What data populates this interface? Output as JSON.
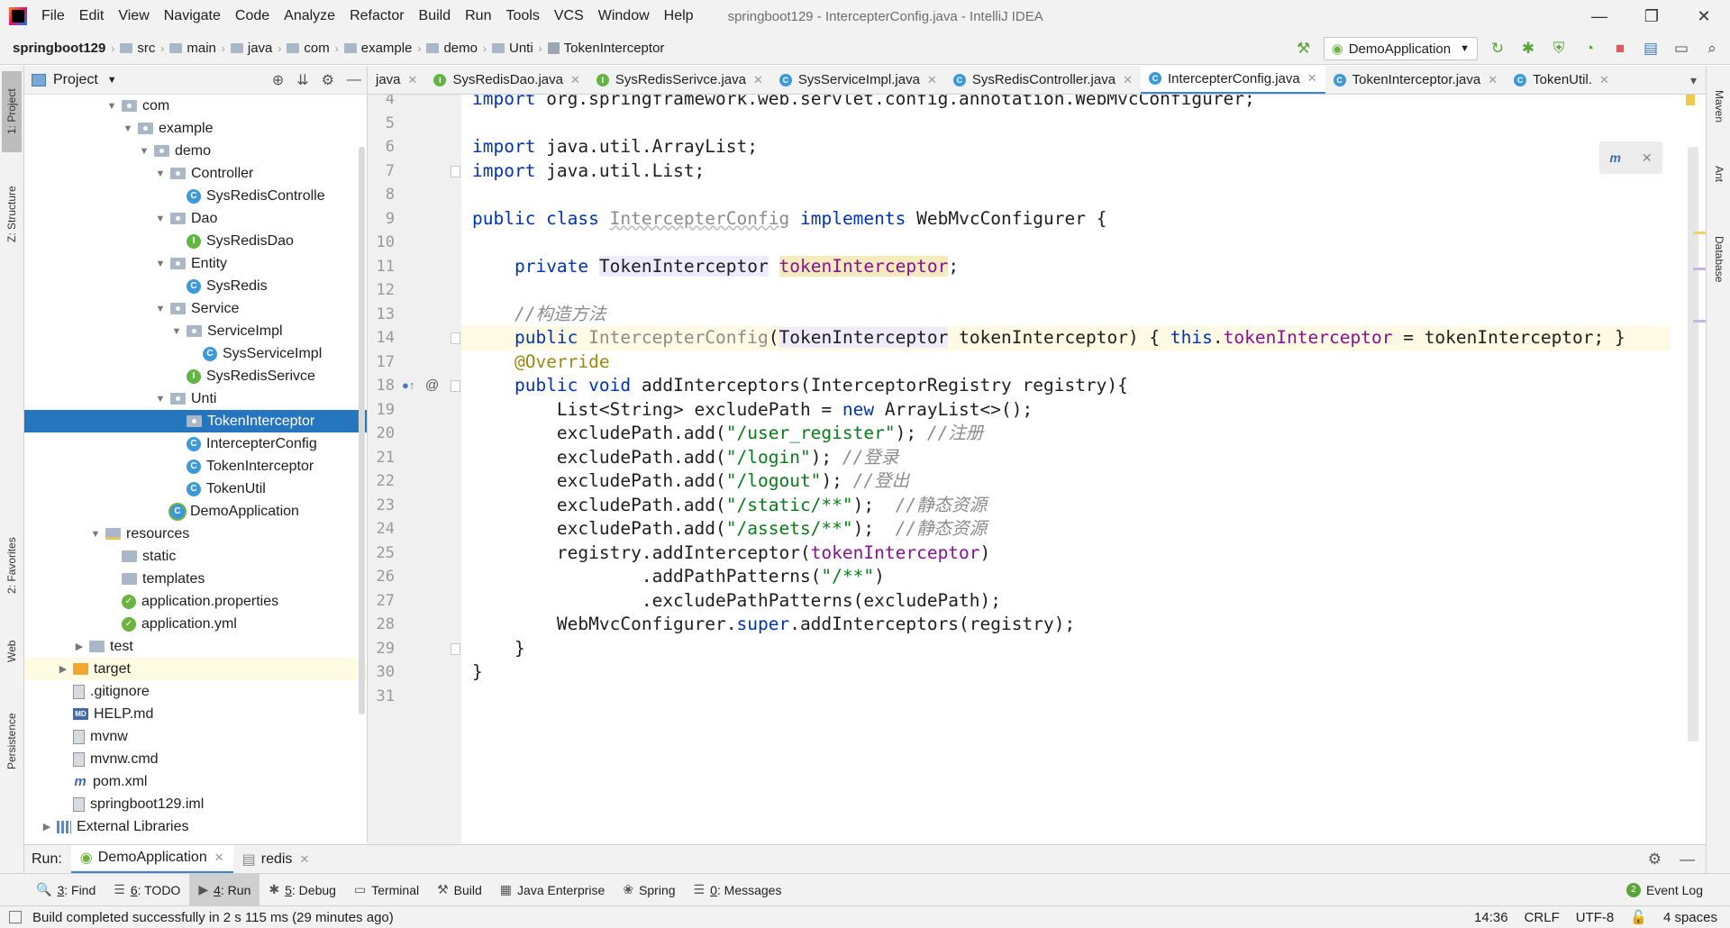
{
  "menu": {
    "items": [
      "File",
      "Edit",
      "View",
      "Navigate",
      "Code",
      "Analyze",
      "Refactor",
      "Build",
      "Run",
      "Tools",
      "VCS",
      "Window",
      "Help"
    ],
    "window_title": "springboot129 - IntercepterConfig.java - IntelliJ IDEA"
  },
  "breadcrumb": [
    "springboot129",
    "src",
    "main",
    "java",
    "com",
    "example",
    "demo",
    "Unti",
    "TokenInterceptor"
  ],
  "run_config": "DemoApplication",
  "project_panel": {
    "title": "Project",
    "tree": [
      {
        "label": "com",
        "icon": "pkg",
        "indent": 4,
        "arrow": "down"
      },
      {
        "label": "example",
        "icon": "pkg",
        "indent": 5,
        "arrow": "down"
      },
      {
        "label": "demo",
        "icon": "pkg",
        "indent": 6,
        "arrow": "down"
      },
      {
        "label": "Controller",
        "icon": "pkg",
        "indent": 7,
        "arrow": "down"
      },
      {
        "label": "SysRedisControlle",
        "icon": "cls",
        "indent": 8,
        "arrow": ""
      },
      {
        "label": "Dao",
        "icon": "pkg",
        "indent": 7,
        "arrow": "down"
      },
      {
        "label": "SysRedisDao",
        "icon": "iface",
        "indent": 8,
        "arrow": ""
      },
      {
        "label": "Entity",
        "icon": "pkg",
        "indent": 7,
        "arrow": "down"
      },
      {
        "label": "SysRedis",
        "icon": "cls",
        "indent": 8,
        "arrow": ""
      },
      {
        "label": "Service",
        "icon": "pkg",
        "indent": 7,
        "arrow": "down"
      },
      {
        "label": "ServiceImpl",
        "icon": "pkg",
        "indent": 8,
        "arrow": "down"
      },
      {
        "label": "SysServiceImpl",
        "icon": "cls",
        "indent": 9,
        "arrow": ""
      },
      {
        "label": "SysRedisSerivce",
        "icon": "iface",
        "indent": 8,
        "arrow": ""
      },
      {
        "label": "Unti",
        "icon": "pkg",
        "indent": 7,
        "arrow": "down"
      },
      {
        "label": "TokenInterceptor",
        "icon": "pkg",
        "indent": 8,
        "arrow": "",
        "selected": true
      },
      {
        "label": "IntercepterConfig",
        "icon": "cls",
        "indent": 8,
        "arrow": ""
      },
      {
        "label": "TokenInterceptor",
        "icon": "cls",
        "indent": 8,
        "arrow": ""
      },
      {
        "label": "TokenUtil",
        "icon": "cls",
        "indent": 8,
        "arrow": ""
      },
      {
        "label": "DemoApplication",
        "icon": "app",
        "indent": 7,
        "arrow": ""
      },
      {
        "label": "resources",
        "icon": "folder-res",
        "indent": 3,
        "arrow": "down"
      },
      {
        "label": "static",
        "icon": "folder",
        "indent": 4,
        "arrow": ""
      },
      {
        "label": "templates",
        "icon": "folder",
        "indent": 4,
        "arrow": ""
      },
      {
        "label": "application.properties",
        "icon": "spring",
        "indent": 4,
        "arrow": ""
      },
      {
        "label": "application.yml",
        "icon": "spring",
        "indent": 4,
        "arrow": ""
      },
      {
        "label": "test",
        "icon": "folder",
        "indent": 2,
        "arrow": "right"
      },
      {
        "label": "target",
        "icon": "folder-orange",
        "indent": 1,
        "arrow": "right",
        "highlight": true
      },
      {
        "label": ".gitignore",
        "icon": "file",
        "indent": 1,
        "arrow": ""
      },
      {
        "label": "HELP.md",
        "icon": "md",
        "indent": 1,
        "arrow": ""
      },
      {
        "label": "mvnw",
        "icon": "file",
        "indent": 1,
        "arrow": ""
      },
      {
        "label": "mvnw.cmd",
        "icon": "file",
        "indent": 1,
        "arrow": ""
      },
      {
        "label": "pom.xml",
        "icon": "maven",
        "indent": 1,
        "arrow": ""
      },
      {
        "label": "springboot129.iml",
        "icon": "file",
        "indent": 1,
        "arrow": ""
      },
      {
        "label": "External Libraries",
        "icon": "lib",
        "indent": 0,
        "arrow": "right"
      }
    ]
  },
  "left_strip": [
    "1: Project",
    "Z: Structure",
    "2: Favorites",
    "Web",
    "Persistence"
  ],
  "right_strip": [
    "Maven",
    "Ant",
    "Database"
  ],
  "tabs": [
    {
      "label": "java",
      "icon": "",
      "active": false
    },
    {
      "label": "SysRedisDao.java",
      "icon": "I",
      "active": false
    },
    {
      "label": "SysRedisSerivce.java",
      "icon": "I",
      "active": false
    },
    {
      "label": "SysServiceImpl.java",
      "icon": "C",
      "active": false
    },
    {
      "label": "SysRedisController.java",
      "icon": "C",
      "active": false
    },
    {
      "label": "IntercepterConfig.java",
      "icon": "C",
      "active": true
    },
    {
      "label": "TokenInterceptor.java",
      "icon": "C",
      "active": false
    },
    {
      "label": "TokenUtil.",
      "icon": "C",
      "active": false
    }
  ],
  "code": {
    "lines": [
      {
        "n": "4",
        "html": "<span class=\"kw\">import</span> org.springframework.web.servlet.config.annotation.WebMvcConfigurer;"
      },
      {
        "n": "5",
        "html": ""
      },
      {
        "n": "6",
        "html": "<span class=\"kw\">import</span> java.util.ArrayList;"
      },
      {
        "n": "7",
        "html": "<span class=\"kw\">import</span> java.util.List;",
        "fold": true
      },
      {
        "n": "8",
        "html": ""
      },
      {
        "n": "9",
        "html": "<span class=\"kw\">public class</span> <span class=\"wavy\">IntercepterConfig</span> <span class=\"kw\">implements</span> WebMvcConfigurer {"
      },
      {
        "n": "10",
        "html": ""
      },
      {
        "n": "11",
        "html": "    <span class=\"kw\">private</span> <span class=\"type-hl\">TokenInterceptor</span> <span class=\"fld field-hl\">tokenInterceptor</span>;"
      },
      {
        "n": "12",
        "html": ""
      },
      {
        "n": "13",
        "html": "    <span class=\"cmt\">//构造方法</span>"
      },
      {
        "n": "14",
        "html": "    <span class=\"kw\">public</span> <span class=\"gray\">IntercepterConfig</span>(<span class=\"type-hl\">TokenInterceptor</span> tokenInterceptor) { <span class=\"kw\">this</span>.<span class=\"fld\">tokenInterceptor</span> = tokenInterceptor; }",
        "fold": true,
        "current": true
      },
      {
        "n": "17",
        "html": "    <span class=\"ann\">@Override</span>"
      },
      {
        "n": "18",
        "html": "    <span class=\"kw\">public void</span> addInterceptors(InterceptorRegistry registry){",
        "fold": true,
        "markers": true
      },
      {
        "n": "19",
        "html": "        List&lt;String&gt; excludePath = <span class=\"kw\">new</span> ArrayList&lt;&gt;();"
      },
      {
        "n": "20",
        "html": "        excludePath.add(<span class=\"str\">\"/user_register\"</span>); <span class=\"cmt\">//注册</span>"
      },
      {
        "n": "21",
        "html": "        excludePath.add(<span class=\"str\">\"/login\"</span>); <span class=\"cmt\">//登录</span>"
      },
      {
        "n": "22",
        "html": "        excludePath.add(<span class=\"str\">\"/logout\"</span>); <span class=\"cmt\">//登出</span>"
      },
      {
        "n": "23",
        "html": "        excludePath.add(<span class=\"str\">\"/static/**\"</span>);  <span class=\"cmt\">//静态资源</span>"
      },
      {
        "n": "24",
        "html": "        excludePath.add(<span class=\"str\">\"/assets/**\"</span>);  <span class=\"cmt\">//静态资源</span>"
      },
      {
        "n": "25",
        "html": "        registry.addInterceptor(<span class=\"fld\">tokenInterceptor</span>)"
      },
      {
        "n": "26",
        "html": "                .addPathPatterns(<span class=\"str\">\"/**\"</span>)"
      },
      {
        "n": "27",
        "html": "                .excludePathPatterns(excludePath);"
      },
      {
        "n": "28",
        "html": "        WebMvcConfigurer.<span class=\"kw\">super</span>.addInterceptors(registry);"
      },
      {
        "n": "29",
        "html": "    }",
        "fold": true
      },
      {
        "n": "30",
        "html": "}"
      },
      {
        "n": "31",
        "html": ""
      }
    ]
  },
  "run_bar": {
    "label": "Run:",
    "tabs": [
      "DemoApplication",
      "redis"
    ]
  },
  "bottom_tools": [
    {
      "num": "3",
      "label": ": Find",
      "icon": "🔍"
    },
    {
      "num": "6",
      "label": ": TODO",
      "icon": "☰"
    },
    {
      "num": "4",
      "label": ": Run",
      "icon": "▶",
      "active": true
    },
    {
      "num": "5",
      "label": ": Debug",
      "icon": "✱"
    },
    {
      "num": "",
      "label": "Terminal",
      "icon": "▭"
    },
    {
      "num": "",
      "label": "Build",
      "icon": "⚒"
    },
    {
      "num": "",
      "label": "Java Enterprise",
      "icon": "▦"
    },
    {
      "num": "",
      "label": "Spring",
      "icon": "❀"
    },
    {
      "num": "0",
      "label": ": Messages",
      "icon": "☰"
    }
  ],
  "event_log": {
    "count": "2",
    "label": "Event Log"
  },
  "status": {
    "message": "Build completed successfully in 2 s 115 ms (29 minutes ago)",
    "position": "14:36",
    "line_sep": "CRLF",
    "encoding": "UTF-8",
    "indent": "4 spaces"
  }
}
